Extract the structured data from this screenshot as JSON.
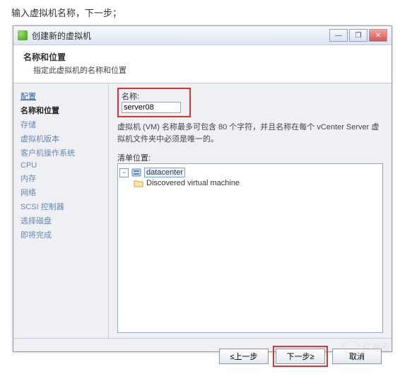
{
  "instruction": "输入虚拟机名称，下一步；",
  "window": {
    "title": "创建新的虚拟机"
  },
  "header": {
    "title": "名称和位置",
    "subtitle": "指定此虚拟机的名称和位置"
  },
  "sidebar": {
    "items": [
      {
        "label": "配置",
        "kind": "link"
      },
      {
        "label": "名称和位置",
        "kind": "active"
      },
      {
        "label": "存储",
        "kind": "dim"
      },
      {
        "label": "虚拟机版本",
        "kind": "dim"
      },
      {
        "label": "客户机操作系统",
        "kind": "dim"
      },
      {
        "label": "CPU",
        "kind": "dim"
      },
      {
        "label": "内存",
        "kind": "dim"
      },
      {
        "label": "网络",
        "kind": "dim"
      },
      {
        "label": "SCSI 控制器",
        "kind": "dim"
      },
      {
        "label": "选择磁盘",
        "kind": "dim"
      },
      {
        "label": "即将完成",
        "kind": "dim"
      }
    ]
  },
  "form": {
    "name_label": "名称:",
    "name_value": "server08",
    "hint": "虚拟机 (VM) 名称最多可包含 80 个字符，并且名称在每个 vCenter Server 虚拟机文件夹中必须是唯一的。",
    "inventory_label": "清单位置:",
    "tree": {
      "expander_symbol": "−",
      "root": "datacenter",
      "children": [
        {
          "label": "Discovered virtual machine"
        }
      ]
    }
  },
  "buttons": {
    "back": "≤上一步",
    "next": "下一步≥",
    "cancel": "取消"
  },
  "watermark": "亿速云"
}
